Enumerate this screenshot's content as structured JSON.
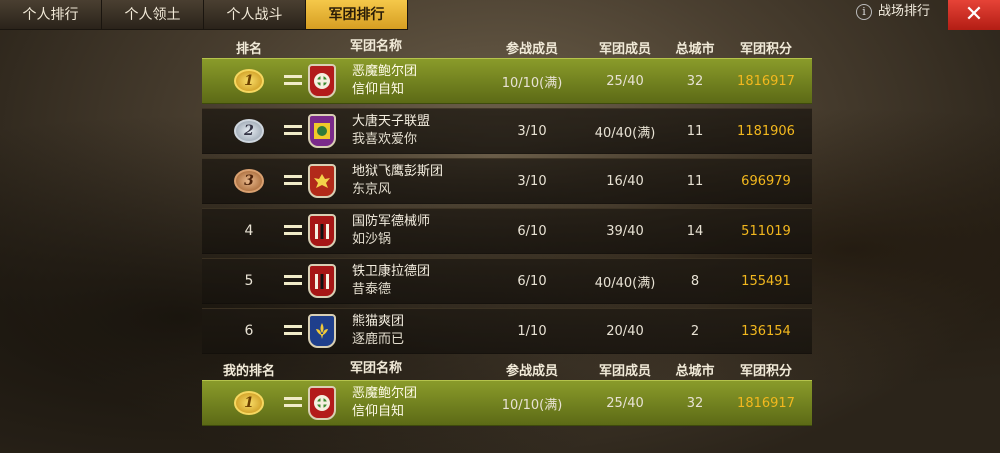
{
  "tabs": [
    {
      "label": "个人排行"
    },
    {
      "label": "个人领土"
    },
    {
      "label": "个人战斗"
    },
    {
      "label": "军团排行"
    }
  ],
  "top_right": {
    "info_symbol": "i",
    "battle_rank_label": "战场排行",
    "close_symbol": "✕"
  },
  "table": {
    "headers": {
      "rank": "排名",
      "legion_name": "军团名称",
      "participating": "参战成员",
      "members": "军团成员",
      "cities": "总城市",
      "score": "军团积分"
    },
    "rows": [
      {
        "rank": "1",
        "medal": "gold",
        "badge_color": "#b31b1b",
        "badge_icon": "shield-cross-icon",
        "name": "恶魔鲍尔团",
        "motto": "信仰自知",
        "participating": "10/10(满)",
        "members": "25/40",
        "cities": "32",
        "score": "1816917",
        "highlight": true
      },
      {
        "rank": "2",
        "medal": "silver",
        "badge_color": "#7a2a8a",
        "badge_icon": "cross-icon",
        "name": "大唐天子联盟",
        "motto": "我喜欢爱你",
        "participating": "3/10",
        "members": "40/40(满)",
        "cities": "11",
        "score": "1181906",
        "highlight": false
      },
      {
        "rank": "3",
        "medal": "bronze",
        "badge_color": "#b22a1a",
        "badge_icon": "eagle-icon",
        "name": "地狱飞鹰彭斯团",
        "motto": "东京风",
        "participating": "3/10",
        "members": "16/40",
        "cities": "11",
        "score": "696979",
        "highlight": false
      },
      {
        "rank": "4",
        "medal": "",
        "badge_color": "#a61616",
        "badge_icon": "stripes-icon",
        "name": "国防军德械师",
        "motto": "如沙锅",
        "participating": "6/10",
        "members": "39/40",
        "cities": "14",
        "score": "511019",
        "highlight": false
      },
      {
        "rank": "5",
        "medal": "",
        "badge_color": "#a61616",
        "badge_icon": "stripes-icon",
        "name": "铁卫康拉德团",
        "motto": "昔泰德",
        "participating": "6/10",
        "members": "40/40(满)",
        "cities": "8",
        "score": "155491",
        "highlight": false
      },
      {
        "rank": "6",
        "medal": "",
        "badge_color": "#1f3f8c",
        "badge_icon": "fleur-de-lis-icon",
        "name": "熊猫爽团",
        "motto": "逐鹿而已",
        "participating": "1/10",
        "members": "20/40",
        "cities": "2",
        "score": "136154",
        "highlight": false
      }
    ]
  },
  "my_rank": {
    "headers": {
      "rank": "我的排名",
      "legion_name": "军团名称",
      "participating": "参战成员",
      "members": "军团成员",
      "cities": "总城市",
      "score": "军团积分"
    },
    "row": {
      "rank": "1",
      "medal": "gold",
      "badge_color": "#b31b1b",
      "badge_icon": "shield-cross-icon",
      "name": "恶魔鲍尔团",
      "motto": "信仰自知",
      "participating": "10/10(满)",
      "members": "25/40",
      "cities": "32",
      "score": "1816917"
    }
  }
}
